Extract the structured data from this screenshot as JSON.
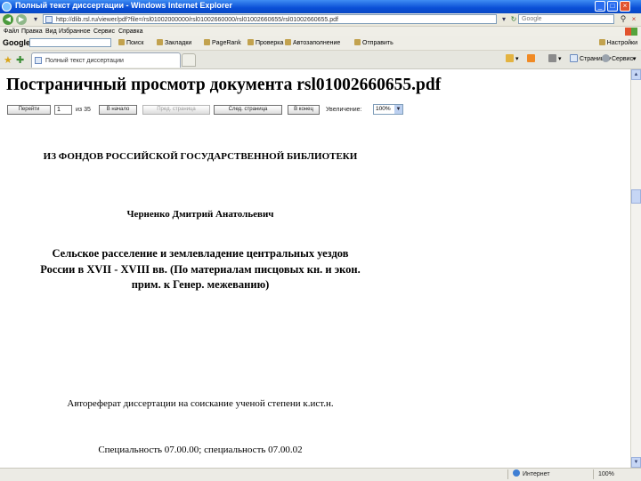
{
  "window": {
    "title": "Полный текст диссертации - Windows Internet Explorer",
    "controls": {
      "minimize": "_",
      "maximize": "□",
      "close": "×"
    }
  },
  "address_bar": {
    "url": "http://dlib.rsl.ru/viewer/pdf?file=/rsl01002000000/rsl01002660000/rsl01002660655/rsl01002660655.pdf",
    "search_placeholder": "Google",
    "refresh_icon": "refresh-icon",
    "stop_icon": "stop-icon"
  },
  "menu": {
    "items": [
      "Файл",
      "Правка",
      "Вид",
      "Избранное",
      "Сервис",
      "Справка"
    ]
  },
  "google_toolbar": {
    "logo": "Google",
    "items": [
      "Поиск",
      "Закладки",
      "PageRank",
      "Проверка",
      "Автозаполнение",
      "Отправить"
    ],
    "settings": "Настройки"
  },
  "tabs": {
    "active_tab": "Полный текст диссертации",
    "commands": [
      "Страница",
      "Сервис"
    ]
  },
  "page": {
    "title": "Постраничный просмотр документа rsl01002660655.pdf",
    "toolbar": {
      "goto_label": "Перейти",
      "page_value": "1",
      "page_count": "из 35",
      "first_label": "В начало",
      "prev_label": "Пред. страница",
      "next_label": "След. страница",
      "last_label": "В конец",
      "zoom_label": "Увеличение:",
      "zoom_value": "100%"
    },
    "document": {
      "library": "ИЗ ФОНДОВ РОССИЙСКОЙ ГОСУДАРСТВЕННОЙ БИБЛИОТЕКИ",
      "author": "Черненко Дмитрий Анатольевич",
      "title": "Сельское расселение и землевладение центральных уездов России в XVII - XVIII вв. (По материалам писцовых кн. и экон. прим. к Генер. межеванию)",
      "type": "Автореферат диссертации на соискание ученой степени к.ист.н.",
      "specialty": "Специальность 07.00.00; специальность 07.00.02"
    }
  },
  "status_bar": {
    "zone": "Интернет",
    "zoom": "100%"
  },
  "colors": {
    "title_bar": "#0a4fd6",
    "chrome": "#eae8dc"
  }
}
